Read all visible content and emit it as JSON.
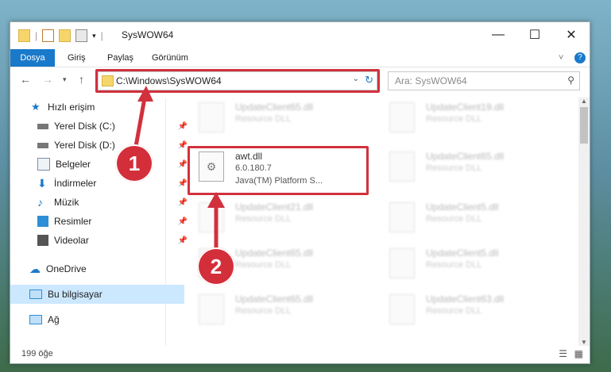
{
  "window": {
    "title": "SysWOW64",
    "controls": {
      "minimize": "—",
      "maximize": "☐",
      "close": "✕"
    }
  },
  "ribbon": {
    "tabs": [
      "Dosya",
      "Giriş",
      "Paylaş",
      "Görünüm"
    ],
    "help_icon": "?",
    "expand_icon": "˅"
  },
  "address": {
    "path": "C:\\Windows\\SysWOW64",
    "search_placeholder": "Ara: SysWOW64"
  },
  "sidebar": {
    "items": [
      {
        "label": "Hızlı erişim",
        "icon": "star-icon",
        "pinned": false
      },
      {
        "label": "Yerel Disk (C:)",
        "icon": "drive-icon",
        "pinned": true
      },
      {
        "label": "Yerel Disk (D:)",
        "icon": "drive-icon",
        "pinned": true
      },
      {
        "label": "Belgeler",
        "icon": "documents-icon",
        "pinned": true
      },
      {
        "label": "İndirmeler",
        "icon": "downloads-icon",
        "pinned": true
      },
      {
        "label": "Müzik",
        "icon": "music-icon",
        "pinned": true
      },
      {
        "label": "Resimler",
        "icon": "pictures-icon",
        "pinned": true
      },
      {
        "label": "Videolar",
        "icon": "videos-icon",
        "pinned": true
      },
      {
        "label": "OneDrive",
        "icon": "cloud-icon",
        "pinned": false
      },
      {
        "label": "Bu bilgisayar",
        "icon": "computer-icon",
        "pinned": false,
        "selected": true
      },
      {
        "label": "Ağ",
        "icon": "network-icon",
        "pinned": false
      }
    ]
  },
  "files": [
    {
      "name": "UpdateClient65.dll",
      "desc": "Resource DLL"
    },
    {
      "name": "UpdateClient19.dll",
      "desc": "Resource DLL"
    },
    {
      "name": "awt.dll",
      "version": "6.0.180.7",
      "desc": "Java(TM) Platform S..."
    },
    {
      "name": "UpdateClient65.dll",
      "desc": "Resource DLL"
    },
    {
      "name": "UpdateClient21.dll",
      "desc": "Resource DLL"
    },
    {
      "name": "UpdateClient5.dll",
      "desc": "Resource DLL"
    },
    {
      "name": "UpdateClient65.dll",
      "desc": "Resource DLL"
    },
    {
      "name": "UpdateClient5.dll",
      "desc": "Resource DLL"
    },
    {
      "name": "UpdateClient65.dll",
      "desc": "Resource DLL"
    },
    {
      "name": "UpdateClient63.dll",
      "desc": "Resource DLL"
    }
  ],
  "status": {
    "count": "199 öğe"
  },
  "annotations": {
    "step1": "1",
    "step2": "2"
  },
  "colors": {
    "accent": "#1979ca",
    "highlight": "#d1313d"
  }
}
